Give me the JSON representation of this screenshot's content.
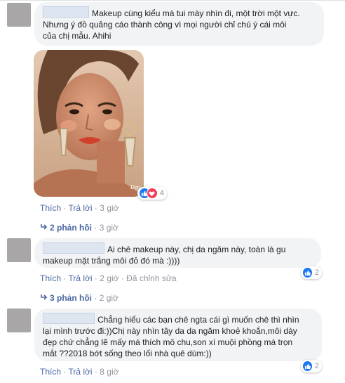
{
  "comments": [
    {
      "text_lines": [
        "Makeup cùng kiểu mà tui mày nhìn đi, một trời một vực.",
        "Nhưng ý đồ quảng cáo thành công vì mọi người chỉ chú ý cái môi",
        "của chị mẫu. Ahihi"
      ],
      "photo_watermark": "Đẹp",
      "actions": {
        "like": "Thích",
        "reply": "Trả lời",
        "time": "3 giờ"
      },
      "reaction_count": "4",
      "replies": {
        "label": "2 phản hồi",
        "time": "3 giờ"
      }
    },
    {
      "text_lines": [
        "Ai chê makeup này, chị da ngăm này, toàn là gu",
        "makeup mặt trắng môi đỏ đó mà :))))"
      ],
      "actions": {
        "like": "Thích",
        "reply": "Trả lời",
        "time": "2 giờ",
        "edited": "Đã chỉnh sửa"
      },
      "reaction_count": "2",
      "replies": {
        "label": "3 phản hồi",
        "time": "2 giờ"
      }
    },
    {
      "text_lines": [
        "Chẳng hiểu các bạn chê ngta cái gì muốn chê thì nhìn",
        "lại mình trước đi:))Chị này nhìn tây da da ngăm khoẻ khoắn,môi dày",
        "đẹp chứ chẳng lẽ mấy má thích mô chu,son xí muội phồng má trọn",
        "mắt ??2018 bớt sống theo lối nhà quê dùm:))"
      ],
      "actions": {
        "like": "Thích",
        "reply": "Trả lời",
        "time": "8 giờ"
      },
      "reaction_count": "2"
    }
  ],
  "separator": "·",
  "icons": {
    "like": "thumbs-up-icon",
    "love": "heart-icon",
    "reply_arrow": "reply-arrow-icon"
  },
  "colors": {
    "link": "#4b67a1",
    "meta": "#90949c",
    "bubble": "#f2f3f5",
    "like": "#1877f2",
    "love": "#f33e58"
  }
}
